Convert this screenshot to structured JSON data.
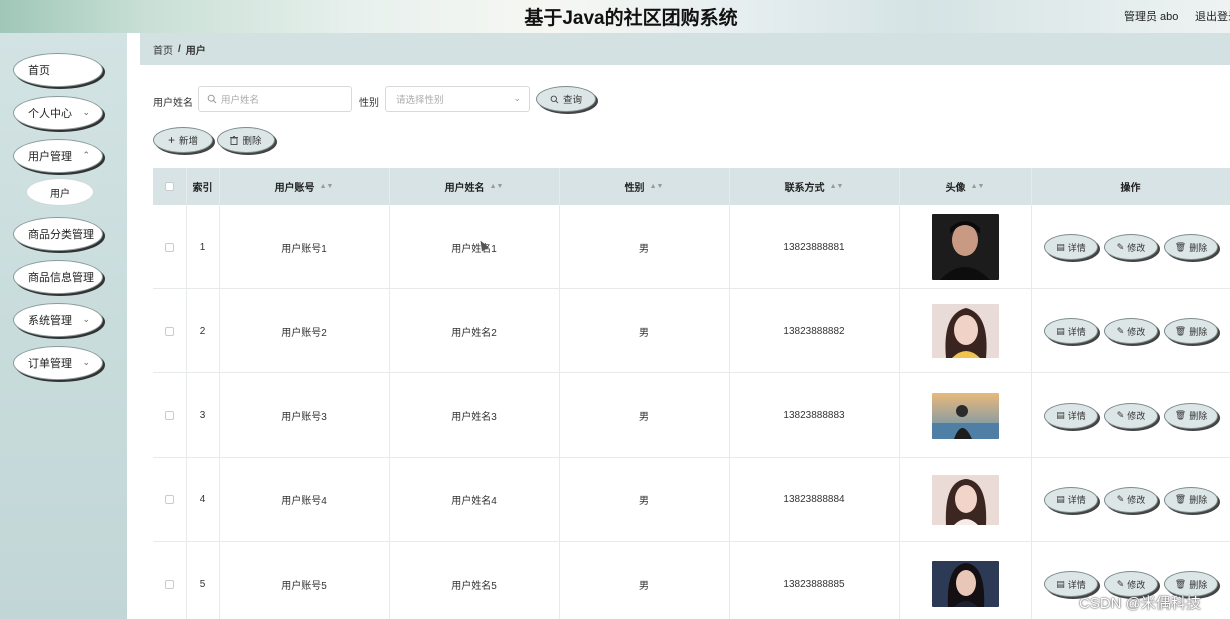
{
  "header": {
    "title": "基于Java的社区团购系统",
    "user": "管理员 abo",
    "logout": "退出登录"
  },
  "sidebar": {
    "items": [
      {
        "label": "首页",
        "has_arrow": false
      },
      {
        "label": "个人中心",
        "has_arrow": true
      },
      {
        "label": "用户管理",
        "has_arrow": true
      },
      {
        "label": "商品分类管理",
        "has_arrow": false
      },
      {
        "label": "商品信息管理",
        "has_arrow": false
      },
      {
        "label": "系统管理",
        "has_arrow": true
      },
      {
        "label": "订单管理",
        "has_arrow": true
      }
    ],
    "submenu_active": "用户"
  },
  "breadcrumb": {
    "home": "首页",
    "sep": "/",
    "current": "用户"
  },
  "search": {
    "name_label": "用户姓名",
    "name_placeholder": "用户姓名",
    "gender_label": "性别",
    "gender_placeholder": "请选择性别",
    "query_label": "查询"
  },
  "toolbar": {
    "add_label": "新增",
    "delete_label": "删除"
  },
  "table": {
    "headers": [
      "索引",
      "用户账号",
      "用户姓名",
      "性别",
      "联系方式",
      "头像",
      "操作"
    ],
    "rows": [
      {
        "index": "1",
        "account": "用户账号1",
        "name": "用户姓名1",
        "gender": "男",
        "phone": "13823888881"
      },
      {
        "index": "2",
        "account": "用户账号2",
        "name": "用户姓名2",
        "gender": "男",
        "phone": "13823888882"
      },
      {
        "index": "3",
        "account": "用户账号3",
        "name": "用户姓名3",
        "gender": "男",
        "phone": "13823888883"
      },
      {
        "index": "4",
        "account": "用户账号4",
        "name": "用户姓名4",
        "gender": "男",
        "phone": "13823888884"
      },
      {
        "index": "5",
        "account": "用户账号5",
        "name": "用户姓名5",
        "gender": "男",
        "phone": "13823888885"
      }
    ],
    "actions": {
      "detail": "详情",
      "edit": "修改",
      "delete": "删除"
    }
  },
  "watermark": "CSDN @米偶科技",
  "colors": {
    "accent": "#d3e1e3",
    "button": "#dde6e7"
  }
}
